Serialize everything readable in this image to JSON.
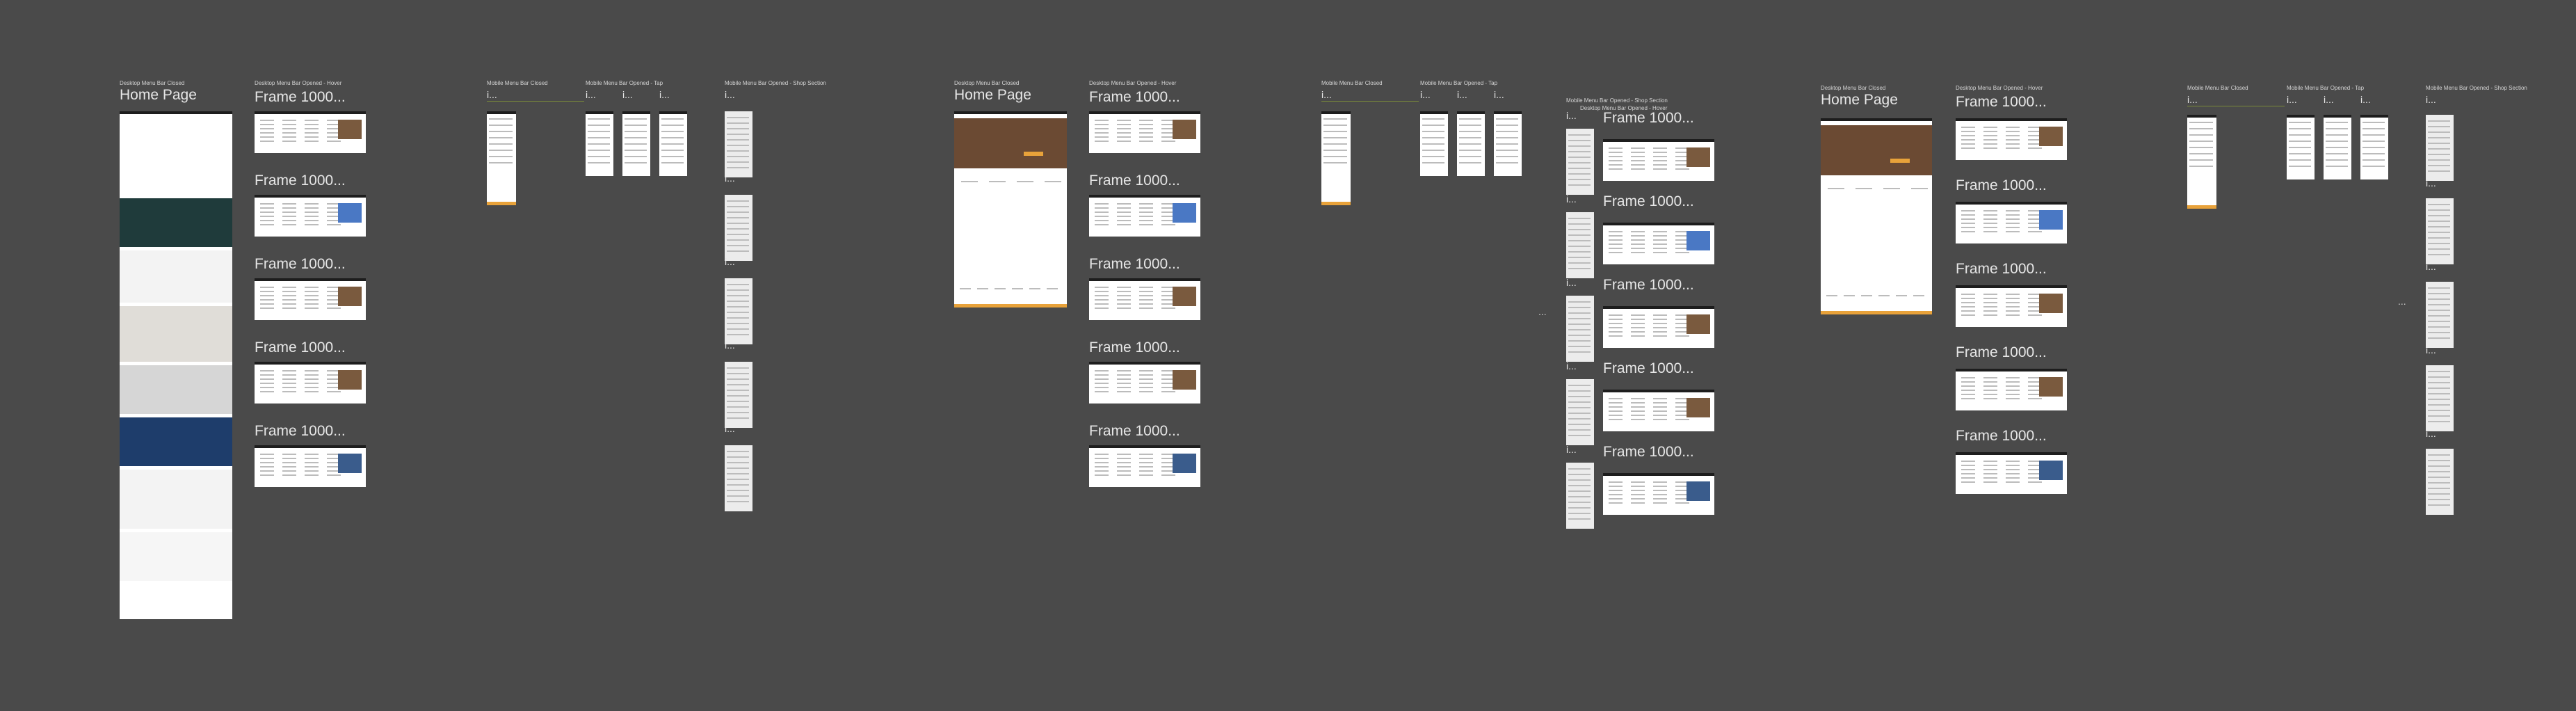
{
  "groups": [
    {
      "home_label": "Desktop Menu Bar Closed",
      "home_title": "Home Page",
      "hover_label": "Desktop Menu Bar Opened - Hover",
      "frames_title": "Frame 1000...",
      "mobile_closed_label": "Mobile Menu Bar Closed",
      "mobile_tap_label": "Mobile Menu Bar Opened - Tap",
      "mobile_shop_label": "Mobile Menu Bar Opened - Shop Section",
      "mobile_short": "i..."
    },
    {
      "home_label": "Desktop Menu Bar Closed",
      "home_title": "Home Page",
      "hover_label": "Desktop Menu Bar Opened - Hover",
      "frames_title": "Frame 1000...",
      "mobile_closed_label": "Mobile Menu Bar Closed",
      "mobile_tap_label": "Mobile Menu Bar Opened - Tap",
      "mobile_shop_label": "Mobile Menu Bar Opened - Shop Section",
      "mobile_short": "i..."
    },
    {
      "home_label": "Desktop Menu Bar Closed",
      "home_title": "Home Page",
      "hover_label": "Desktop Menu Bar Opened - Hover",
      "frames_title": "Frame 1000...",
      "mobile_closed_label": "Mobile Menu Bar Closed",
      "mobile_tap_label": "Mobile Menu Bar Opened - Tap",
      "mobile_shop_label": "Mobile Menu Bar Opened - Shop Section",
      "mobile_short": "i..."
    }
  ],
  "middle_section": {
    "label_a": "Mobile Menu Bar Opened - Shop Section",
    "label_b": "Desktop Menu Bar Opened - Hover",
    "frames_title": "Frame 1000...",
    "mobile_short": "i..."
  },
  "ellipsis": "...",
  "colors": {
    "canvas": "#4a4a4a",
    "frame": "#ffffff",
    "accent": "#e8a23a",
    "dark_nav": "#1d1d1d"
  }
}
